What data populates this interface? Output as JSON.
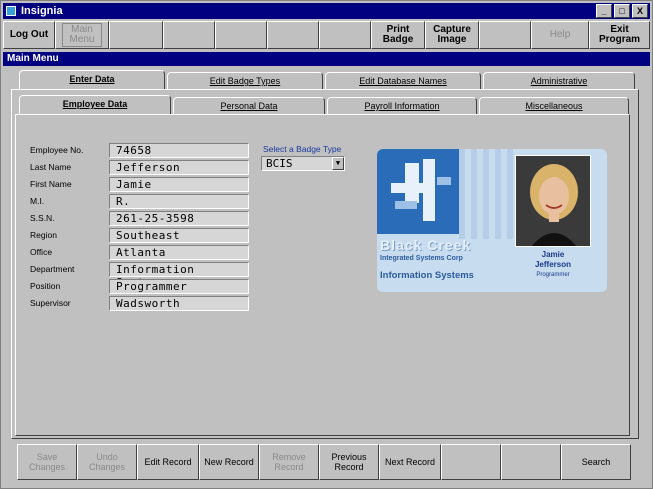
{
  "window": {
    "title": "Insignia",
    "minimize": "_",
    "maximize": "□",
    "close": "X"
  },
  "toolbar": {
    "logout": "Log Out",
    "main_menu": "Main\nMenu",
    "print_badge": "Print\nBadge",
    "capture_image": "Capture\nImage",
    "help": "Help",
    "exit_program": "Exit\nProgram"
  },
  "menubar": {
    "title": "Main Menu"
  },
  "top_tabs": [
    "Enter Data",
    "Edit Badge Types",
    "Edit Database Names",
    "Administrative"
  ],
  "sub_tabs": [
    "Employee Data",
    "Personal Data",
    "Payroll Information",
    "Miscellaneous"
  ],
  "form": {
    "labels": [
      "Employee No.",
      "Last Name",
      "First Name",
      "M.I.",
      "S.S.N.",
      "Region",
      "Office",
      "Department",
      "Position",
      "Supervisor"
    ],
    "values": [
      "74658",
      "Jefferson",
      "Jamie",
      "R.",
      "261-25-3598",
      "Southeast",
      "Atlanta",
      "Information Systems",
      "Programmer",
      "Wadsworth"
    ]
  },
  "badge_type": {
    "label": "Select a Badge Type",
    "selected": "BCIS"
  },
  "badge": {
    "company": "Black Creek",
    "subcompany": "Integrated Systems Corp",
    "department": "Information Systems",
    "first_name": "Jamie",
    "last_name": "Jefferson",
    "title": "Programmer"
  },
  "bottom": {
    "save": "Save\nChanges",
    "undo": "Undo\nChanges",
    "edit": "Edit Record",
    "new": "New Record",
    "remove": "Remove\nRecord",
    "previous": "Previous\nRecord",
    "next": "Next Record",
    "search": "Search"
  }
}
